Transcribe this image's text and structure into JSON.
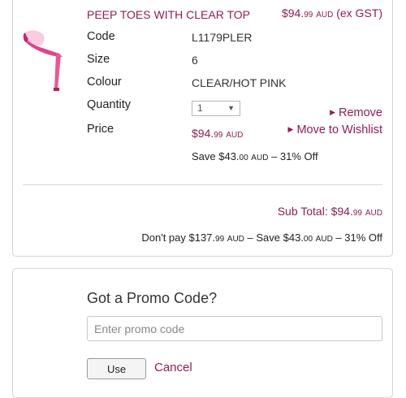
{
  "colors": {
    "accent": "#8e1f4f",
    "shoe_pink": "#e0448a"
  },
  "item": {
    "image_icon": "pink-platform-sandal-image",
    "name": "PEEP TOES WITH CLEAR TOP",
    "top_price": {
      "main": "$94.",
      "cents": "99",
      "currency": "AUD",
      "suffix": "(ex GST)"
    },
    "labels": {
      "code": "Code",
      "size": "Size",
      "colour": "Colour",
      "quantity": "Quantity",
      "price": "Price"
    },
    "code": "L1179PLER",
    "size": "6",
    "colour": "CLEAR/HOT PINK",
    "quantity": "1",
    "price": {
      "main": "$94.",
      "cents": "99",
      "currency": "AUD"
    },
    "save": {
      "prefix": "Save $43.",
      "cents": "00",
      "currency": "AUD",
      "suffix": "– 31% Off"
    },
    "remove_label": "Remove",
    "wishlist_label": "Move to Wishlist"
  },
  "totals": {
    "subtotal": {
      "label": "Sub Total: $94.",
      "cents": "99",
      "currency": "AUD"
    },
    "dontpay": {
      "prefix": "Don't pay $137.",
      "cents1": "99",
      "currency1": "AUD",
      "middle": "– Save $43.",
      "cents2": "00",
      "currency2": "AUD",
      "suffix": "– 31% Off"
    }
  },
  "promo": {
    "title": "Got a Promo Code?",
    "placeholder": "Enter promo code",
    "use_label": "Use",
    "cancel_label": "Cancel"
  }
}
